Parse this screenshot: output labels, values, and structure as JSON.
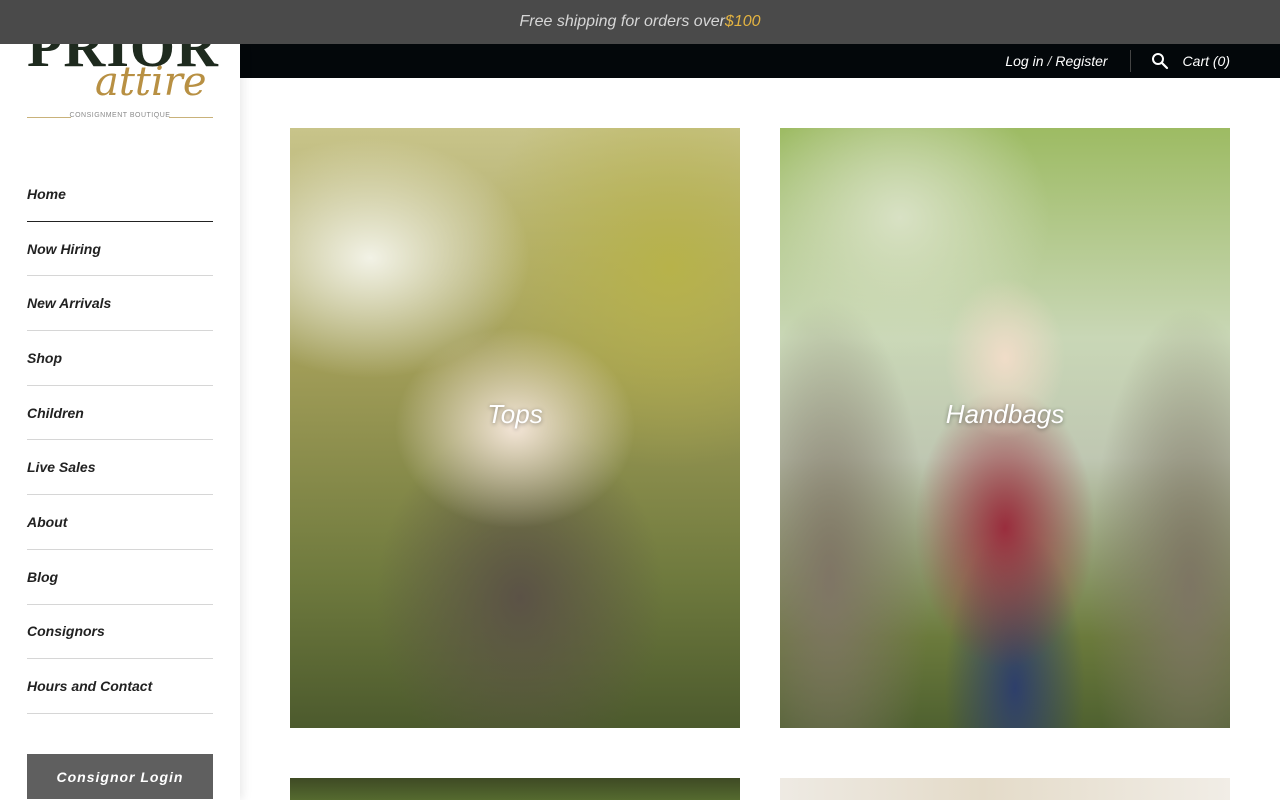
{
  "announcement": {
    "text": "Free shipping for orders over ",
    "amount": "$100"
  },
  "brand": {
    "logo_word": "PRIOR",
    "logo_script": "attire",
    "logo_tagline": "CONSIGNMENT BOUTIQUE"
  },
  "header": {
    "login": "Log in",
    "slash": "/",
    "register": "Register",
    "search_icon": "search-icon",
    "cart": "Cart (0)"
  },
  "sidebar": {
    "items": [
      {
        "label": "Home"
      },
      {
        "label": "Now Hiring"
      },
      {
        "label": "New Arrivals"
      },
      {
        "label": "Shop"
      },
      {
        "label": "Children"
      },
      {
        "label": "Live Sales"
      },
      {
        "label": "About"
      },
      {
        "label": "Blog"
      },
      {
        "label": "Consignors"
      },
      {
        "label": "Hours and Contact"
      }
    ],
    "consignor_login": "Consignor Login"
  },
  "collections": [
    {
      "label": "Tops"
    },
    {
      "label": "Handbags"
    }
  ],
  "colors": {
    "announcement_bg": "#4a4a4a",
    "price_accent": "#e3b341",
    "header_bg": "#03070a",
    "logo_gold": "#b89043",
    "button_bg": "#5f5f5f"
  }
}
